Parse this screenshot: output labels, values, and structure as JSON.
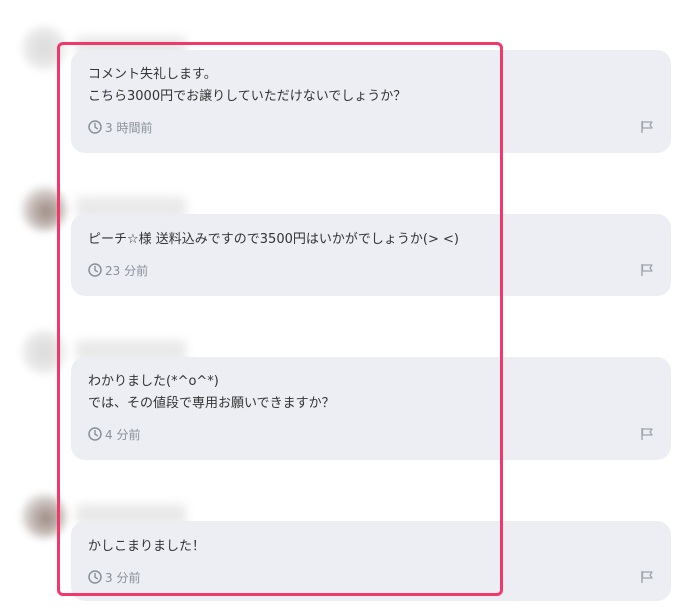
{
  "comments": [
    {
      "lines": [
        "コメント失礼します。",
        "こちら3000円でお譲りしていただけないでしょうか？"
      ],
      "time": "3 時間前"
    },
    {
      "lines": [
        "ピーチ☆様 送料込みですので3500円はいかがでしょうか(> <)"
      ],
      "time": "23 分前"
    },
    {
      "lines": [
        "わかりました(*^o^*)",
        "では、その値段で専用お願いできますか？"
      ],
      "time": "4 分前"
    },
    {
      "lines": [
        "かしこまりました！"
      ],
      "time": "3 分前"
    }
  ],
  "colors": {
    "highlight": "#f0396a",
    "bubble": "#eceef3",
    "meta": "#8a8f99"
  },
  "icons": {
    "time": "clock-icon",
    "report": "flag-icon"
  }
}
